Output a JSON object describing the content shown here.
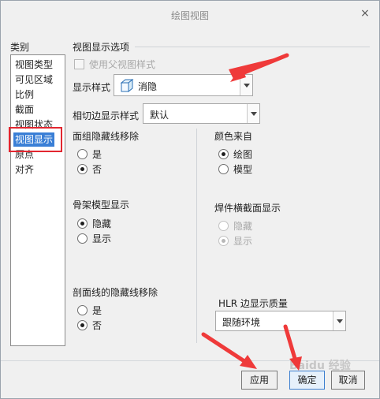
{
  "window": {
    "title": "绘图视图",
    "close_glyph": "×"
  },
  "category": {
    "label": "类别",
    "items": [
      "视图类型",
      "可见区域",
      "比例",
      "截面",
      "视图状态",
      "视图显示",
      "原点",
      "对齐"
    ],
    "selected_index": 5
  },
  "options": {
    "section_title": "视图显示选项",
    "use_parent_style": {
      "label": "使用父视图样式",
      "checked": false,
      "enabled": false
    },
    "display_style": {
      "label": "显示样式",
      "value": "消隐",
      "icon": "hidden-line-cube-icon"
    },
    "tangent_edge": {
      "label": "相切边显示样式",
      "value": "默认"
    },
    "face_group_hidden": {
      "label": "面组隐藏线移除",
      "options": [
        "是",
        "否"
      ],
      "selected": "否"
    },
    "color_from": {
      "label": "颜色来自",
      "options": [
        "绘图",
        "模型"
      ],
      "selected": "绘图"
    },
    "skeleton_display": {
      "label": "骨架模型显示",
      "options": [
        "隐藏",
        "显示"
      ],
      "selected": "隐藏"
    },
    "weld_section": {
      "label": "焊件横截面显示",
      "options": [
        "隐藏",
        "显示"
      ],
      "selected": "显示",
      "enabled": false
    },
    "section_hidden": {
      "label": "剖面线的隐藏线移除",
      "options": [
        "是",
        "否"
      ],
      "selected": "否"
    },
    "hlr_quality": {
      "label": "HLR 边显示质量",
      "value": "跟随环境"
    }
  },
  "buttons": {
    "apply": "应用",
    "ok": "确定",
    "cancel": "取消"
  },
  "watermark": "Baidu 经验",
  "colors": {
    "selection": "#3a7fd6",
    "highlight_box": "#e2262f",
    "annotation_arrow": "#ef3a3a"
  }
}
